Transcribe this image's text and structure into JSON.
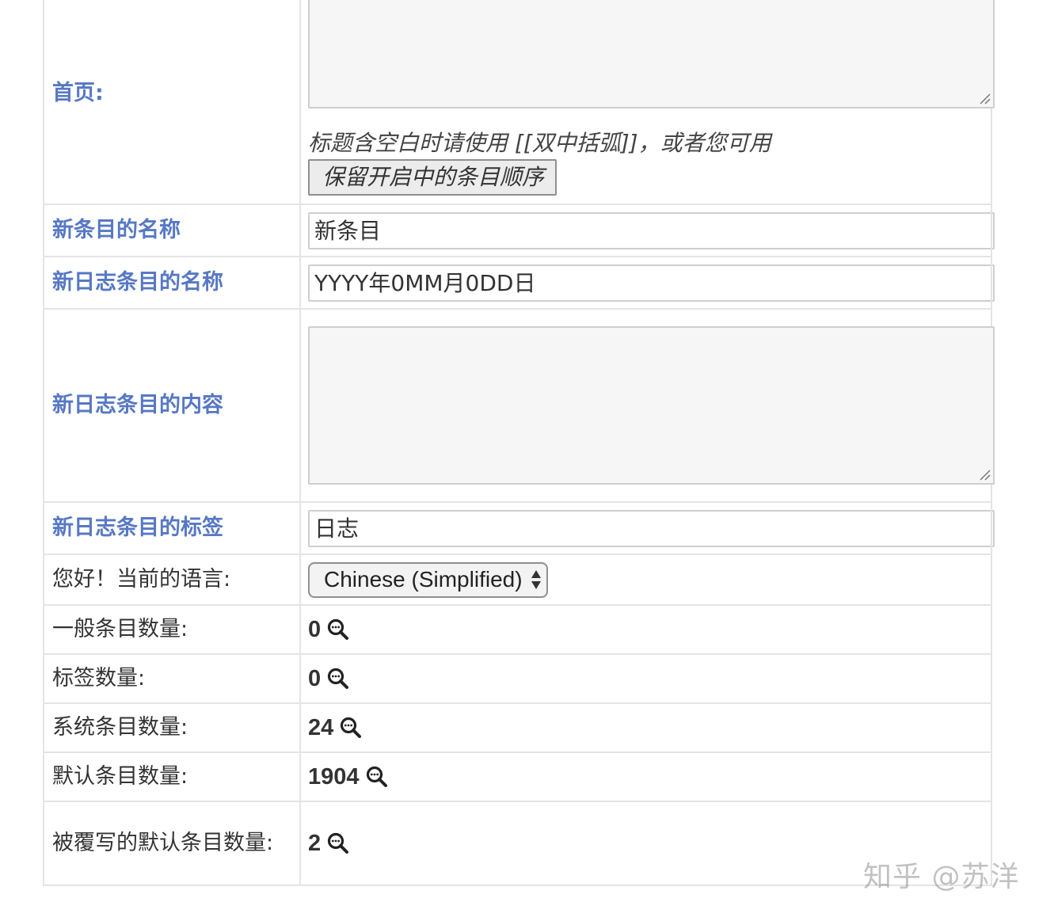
{
  "rows": {
    "homepage": {
      "label": "首页:"
    },
    "homepage_hint": "标题含空白时请使用 [[双中括弧]]，或者您可用",
    "keep_order_button": "保留开启中的条目顺序",
    "new_entry_name": {
      "label": "新条目的名称",
      "value": "新条目"
    },
    "new_journal_name": {
      "label": "新日志条目的名称",
      "value": "YYYY年0MM月0DD日"
    },
    "new_journal_content": {
      "label": "新日志条目的内容"
    },
    "new_journal_tags": {
      "label": "新日志条目的标签",
      "value": "日志"
    },
    "language": {
      "label": "您好！当前的语言:",
      "selected": "Chinese (Simplified)"
    },
    "ordinary_count": {
      "label": "一般条目数量:",
      "value": "0"
    },
    "tag_count": {
      "label": "标签数量:",
      "value": "0"
    },
    "system_count": {
      "label": "系统条目数量:",
      "value": "24"
    },
    "default_count": {
      "label": "默认条目数量:",
      "value": "1904"
    },
    "overridden_count": {
      "label": "被覆写的默认条目数量:",
      "value": "2"
    }
  },
  "watermark": "知乎 @苏洋",
  "colors": {
    "link": "#5778c4",
    "border": "#e4e4e4",
    "input_bg": "#f6f6f6"
  },
  "icons": {
    "search": "magnifier-ellipsis-icon",
    "resize": "resize-grip-icon",
    "select": "updown-arrows-icon"
  }
}
